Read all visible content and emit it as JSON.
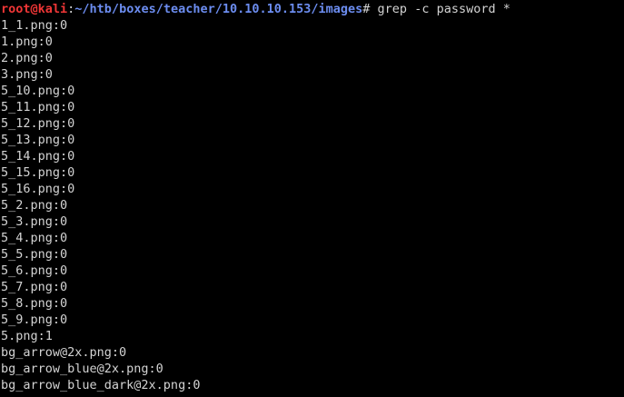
{
  "terminal": {
    "prompt": {
      "user_host": "root@kali",
      "separator": ":",
      "path": "~/htb/boxes/teacher/10.10.10.153/images",
      "symbol": "#",
      "command": " grep -c password *"
    },
    "output_lines": [
      "1_1.png:0",
      "1.png:0",
      "2.png:0",
      "3.png:0",
      "5_10.png:0",
      "5_11.png:0",
      "5_12.png:0",
      "5_13.png:0",
      "5_14.png:0",
      "5_15.png:0",
      "5_16.png:0",
      "5_2.png:0",
      "5_3.png:0",
      "5_4.png:0",
      "5_5.png:0",
      "5_6.png:0",
      "5_7.png:0",
      "5_8.png:0",
      "5_9.png:0",
      "5.png:1",
      "bg_arrow@2x.png:0",
      "bg_arrow_blue@2x.png:0",
      "bg_arrow_blue_dark@2x.png:0"
    ]
  },
  "colors": {
    "background": "#000000",
    "text": "#d3d3d3",
    "user_host": "#f03636",
    "path": "#6c8df0"
  }
}
